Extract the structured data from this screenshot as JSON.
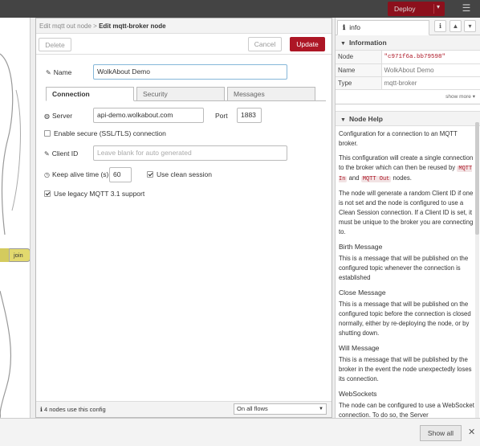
{
  "topbar": {
    "deploy_label": "Deploy"
  },
  "workspace": {
    "join_label": "join"
  },
  "tray": {
    "breadcrumb_parent": "Edit mqtt out node",
    "breadcrumb_sep": " > ",
    "breadcrumb_current": "Edit mqtt-broker node",
    "delete_label": "Delete",
    "cancel_label": "Cancel",
    "update_label": "Update",
    "name_label": "Name",
    "name_value": "WolkAbout Demo",
    "tabs": [
      {
        "label": "Connection",
        "active": true
      },
      {
        "label": "Security",
        "active": false
      },
      {
        "label": "Messages",
        "active": false
      }
    ],
    "server_label": "Server",
    "server_value": "api-demo.wolkabout.com",
    "port_label": "Port",
    "port_value": "1883",
    "ssl_label": "Enable secure (SSL/TLS) connection",
    "ssl_checked": false,
    "client_id_label": "Client ID",
    "client_id_placeholder": "Leave blank for auto generated",
    "keepalive_label": "Keep alive time (s)",
    "keepalive_value": "60",
    "clean_session_label": "Use clean session",
    "clean_session_checked": true,
    "legacy_label": "Use legacy MQTT 3.1 support",
    "legacy_checked": true,
    "footer_note": "4 nodes use this config",
    "scope_value": "On all flows"
  },
  "sidebar": {
    "tab_label": "info",
    "information_title": "Information",
    "rows": [
      {
        "key": "Node",
        "value": "\"c971f6a.bb79598\""
      },
      {
        "key": "Name",
        "value": "WolkAbout Demo"
      },
      {
        "key": "Type",
        "value": "mqtt-broker"
      }
    ],
    "show_more": "show more",
    "help_title": "Node Help",
    "help_p1": "Configuration for a connection to an MQTT broker.",
    "help_p2a": "This configuration will create a single connection to the broker which can then be reused by ",
    "help_code1": "MQTT In",
    "help_p2b": " and ",
    "help_code2": "MQTT Out",
    "help_p2c": " nodes.",
    "help_p3": "The node will generate a random Client ID if one is not set and the node is configured to use a Clean Session connection. If a Client ID is set, it must be unique to the broker you are connecting to.",
    "h_birth": "Birth Message",
    "p_birth": "This is a message that will be published on the configured topic whenever the connection is established",
    "h_close": "Close Message",
    "p_close": "This is a message that will be published on the configured topic before the connection is closed normally, either by re-deploying the node, or by shutting down.",
    "h_will": "Will Message",
    "p_will": "This is a message that will be published by the broker in the event the node unexpectedly loses its connection.",
    "h_ws": "WebSockets",
    "p_ws": "The node can be configured to use a WebSocket connection. To do so, the Server"
  },
  "bottombar": {
    "show_all_label": "Show all"
  },
  "colors": {
    "accent": "#ad1625",
    "deploy": "#8c101c"
  }
}
